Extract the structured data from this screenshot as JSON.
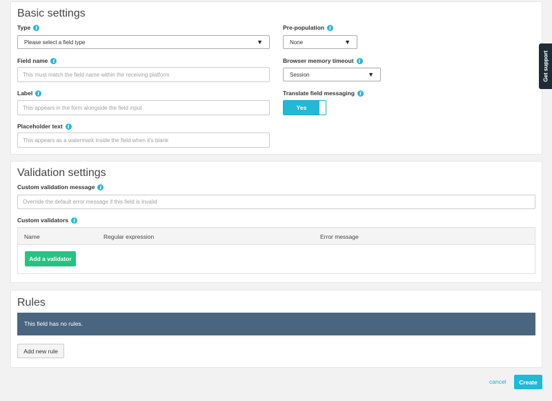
{
  "basic": {
    "title": "Basic settings",
    "type": {
      "label": "Type",
      "value": "Please select a field type"
    },
    "field_name": {
      "label": "Field name",
      "placeholder": "This must match the field name within the receiving platform"
    },
    "label": {
      "label": "Label",
      "placeholder": "This appears in the form alongside the field input"
    },
    "placeholder_text": {
      "label": "Placeholder text",
      "placeholder": "This appears as a watermark inside the field when it's blank"
    },
    "prepopulation": {
      "label": "Pre-population",
      "value": "None"
    },
    "memory_timeout": {
      "label": "Browser memory timeout",
      "value": "Session"
    },
    "translate": {
      "label": "Translate field messaging",
      "value": "Yes"
    }
  },
  "validation": {
    "title": "Validation settings",
    "message": {
      "label": "Custom validation message",
      "placeholder": "Override the default error message if this field is invalid"
    },
    "validators": {
      "label": "Custom validators",
      "columns": [
        "Name",
        "Regular expression",
        "Error message"
      ],
      "add_label": "Add a validator"
    }
  },
  "rules": {
    "title": "Rules",
    "empty_text": "This field has no rules.",
    "add_label": "Add new rule"
  },
  "footer": {
    "cancel_label": "cancel",
    "create_label": "Create"
  },
  "support_label": "Get support",
  "info_glyph": "i",
  "caret_glyph": "▼",
  "colors": {
    "accent": "#22b8d6",
    "green": "#26c281",
    "notice": "#4a6580"
  }
}
